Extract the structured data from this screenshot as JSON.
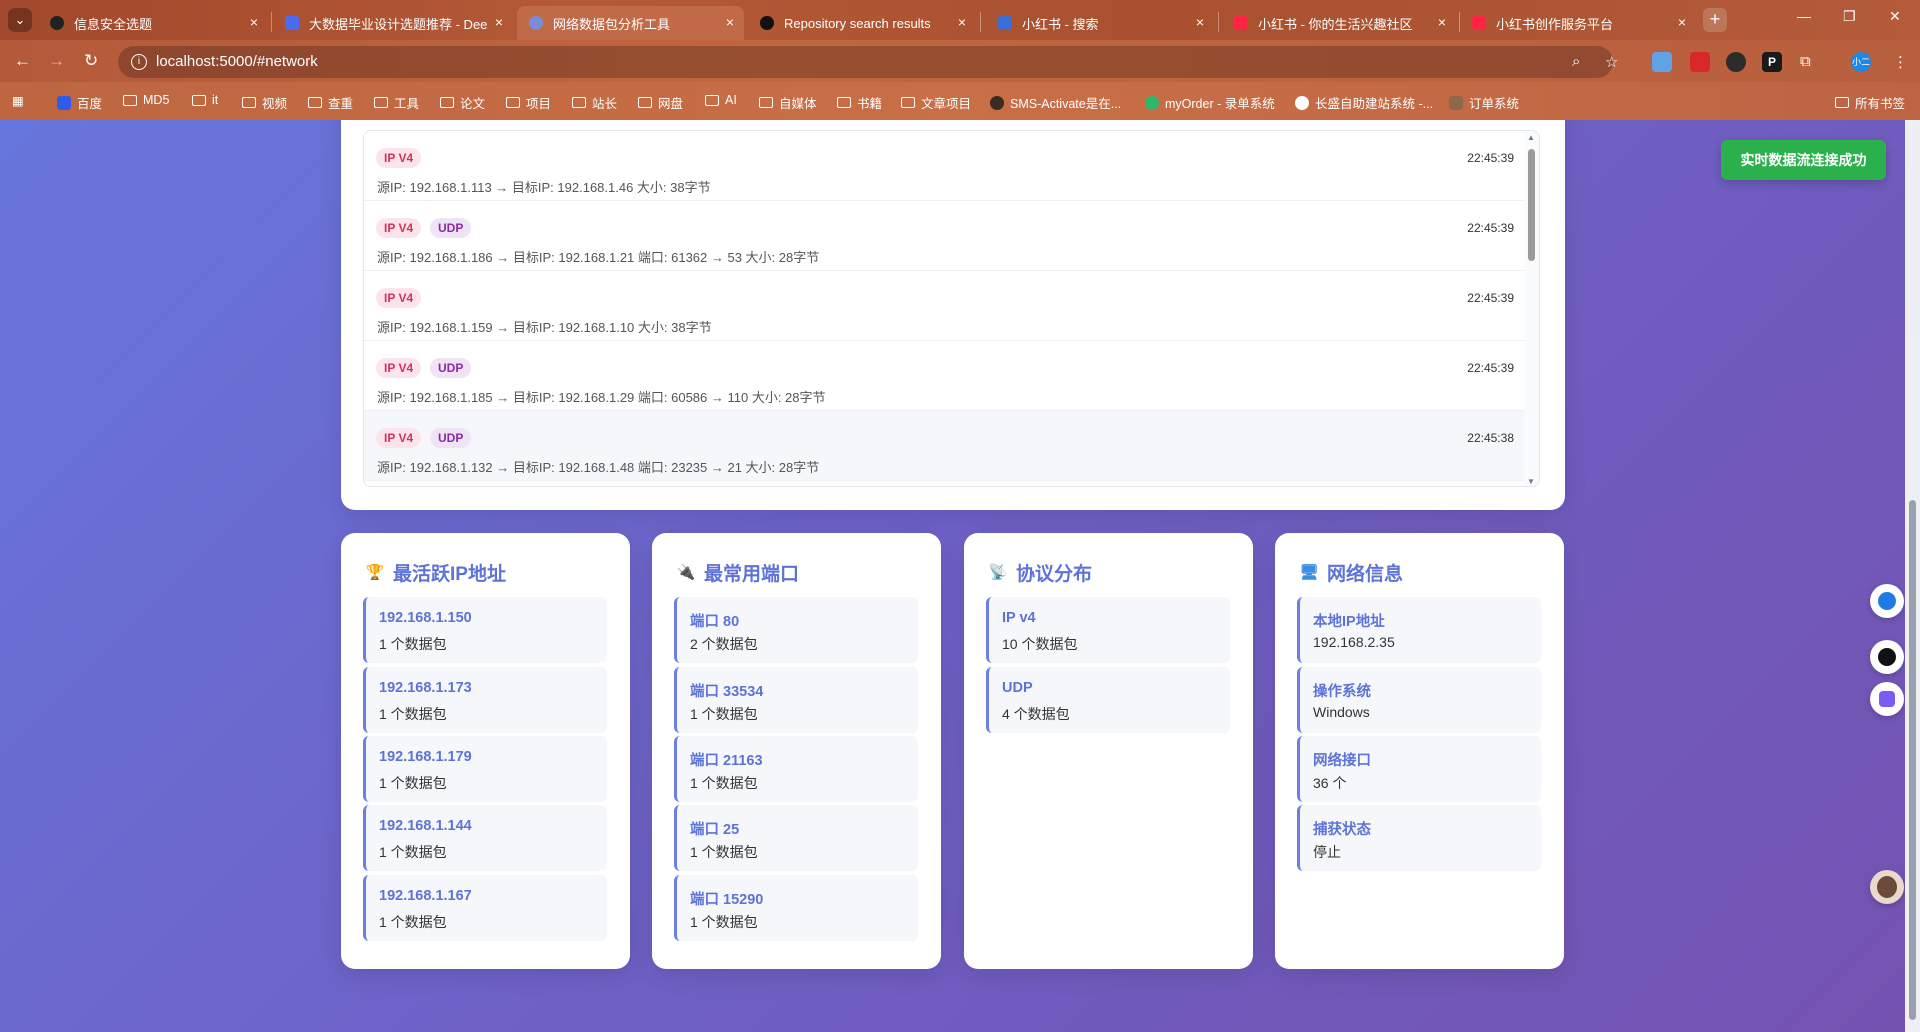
{
  "browser": {
    "tabs": [
      {
        "title": "信息安全选题",
        "active": false
      },
      {
        "title": "大数据毕业设计选题推荐 - Dee",
        "active": false
      },
      {
        "title": "网络数据包分析工具",
        "active": true
      },
      {
        "title": "Repository search results",
        "active": false
      },
      {
        "title": "小红书 - 搜索",
        "active": false
      },
      {
        "title": "小红书 - 你的生活兴趣社区",
        "active": false
      },
      {
        "title": "小红书创作服务平台",
        "active": false
      }
    ],
    "tab_close_glyph": "×",
    "new_tab_glyph": "+",
    "url": "localhost:5000/#network",
    "bookmarks": [
      "百度",
      "MD5",
      "it",
      "视频",
      "查重",
      "工具",
      "论文",
      "项目",
      "站长",
      "网盘",
      "AI",
      "自媒体",
      "书籍",
      "文章项目",
      "SMS-Activate是在...",
      "myOrder - 录单系统",
      "长盛自助建站系统 -...",
      "订单系统"
    ],
    "all_bookmarks": "所有书签",
    "profile_badge": "小二"
  },
  "toast": {
    "text": "实时数据流连接成功"
  },
  "packets": [
    {
      "badges": [
        "IP V4"
      ],
      "time": "22:45:39",
      "detail": "源IP: 192.168.1.113 → 目标IP: 192.168.1.46 大小: 38字节"
    },
    {
      "badges": [
        "IP V4",
        "UDP"
      ],
      "time": "22:45:39",
      "detail": "源IP: 192.168.1.186 → 目标IP: 192.168.1.21 端口: 61362 → 53 大小: 28字节"
    },
    {
      "badges": [
        "IP V4"
      ],
      "time": "22:45:39",
      "detail": "源IP: 192.168.1.159 → 目标IP: 192.168.1.10 大小: 38字节"
    },
    {
      "badges": [
        "IP V4",
        "UDP"
      ],
      "time": "22:45:39",
      "detail": "源IP: 192.168.1.185 → 目标IP: 192.168.1.29 端口: 60586 → 110 大小: 28字节"
    },
    {
      "badges": [
        "IP V4",
        "UDP"
      ],
      "time": "22:45:38",
      "detail": "源IP: 192.168.1.132 → 目标IP: 192.168.1.48 端口: 23235 → 21 大小: 28字节"
    }
  ],
  "stats": {
    "top_ips": {
      "title": "最活跃IP地址",
      "icon": "trophy-icon",
      "items": [
        {
          "k": "192.168.1.150",
          "v": "1 个数据包"
        },
        {
          "k": "192.168.1.173",
          "v": "1 个数据包"
        },
        {
          "k": "192.168.1.179",
          "v": "1 个数据包"
        },
        {
          "k": "192.168.1.144",
          "v": "1 个数据包"
        },
        {
          "k": "192.168.1.167",
          "v": "1 个数据包"
        }
      ]
    },
    "top_ports": {
      "title": "最常用端口",
      "icon": "plug-icon",
      "items": [
        {
          "k": "端口 80",
          "v": "2 个数据包"
        },
        {
          "k": "端口 33534",
          "v": "1 个数据包"
        },
        {
          "k": "端口 21163",
          "v": "1 个数据包"
        },
        {
          "k": "端口 25",
          "v": "1 个数据包"
        },
        {
          "k": "端口 15290",
          "v": "1 个数据包"
        }
      ]
    },
    "protocols": {
      "title": "协议分布",
      "icon": "satellite-icon",
      "items": [
        {
          "k": "IP v4",
          "v": "10 个数据包"
        },
        {
          "k": "UDP",
          "v": "4 个数据包"
        }
      ]
    },
    "network_info": {
      "title": "网络信息",
      "icon": "computer-icon",
      "items": [
        {
          "k": "本地IP地址",
          "v": "192.168.2.35"
        },
        {
          "k": "操作系统",
          "v": "Windows"
        },
        {
          "k": "网络接口",
          "v": "36 个"
        },
        {
          "k": "捕获状态",
          "v": "停止"
        }
      ]
    }
  },
  "colors": {
    "accent": "#5d73d8",
    "toast_green": "#2bb14c",
    "ip_badge": "#d2335c",
    "udp_badge": "#8a2aa6"
  }
}
